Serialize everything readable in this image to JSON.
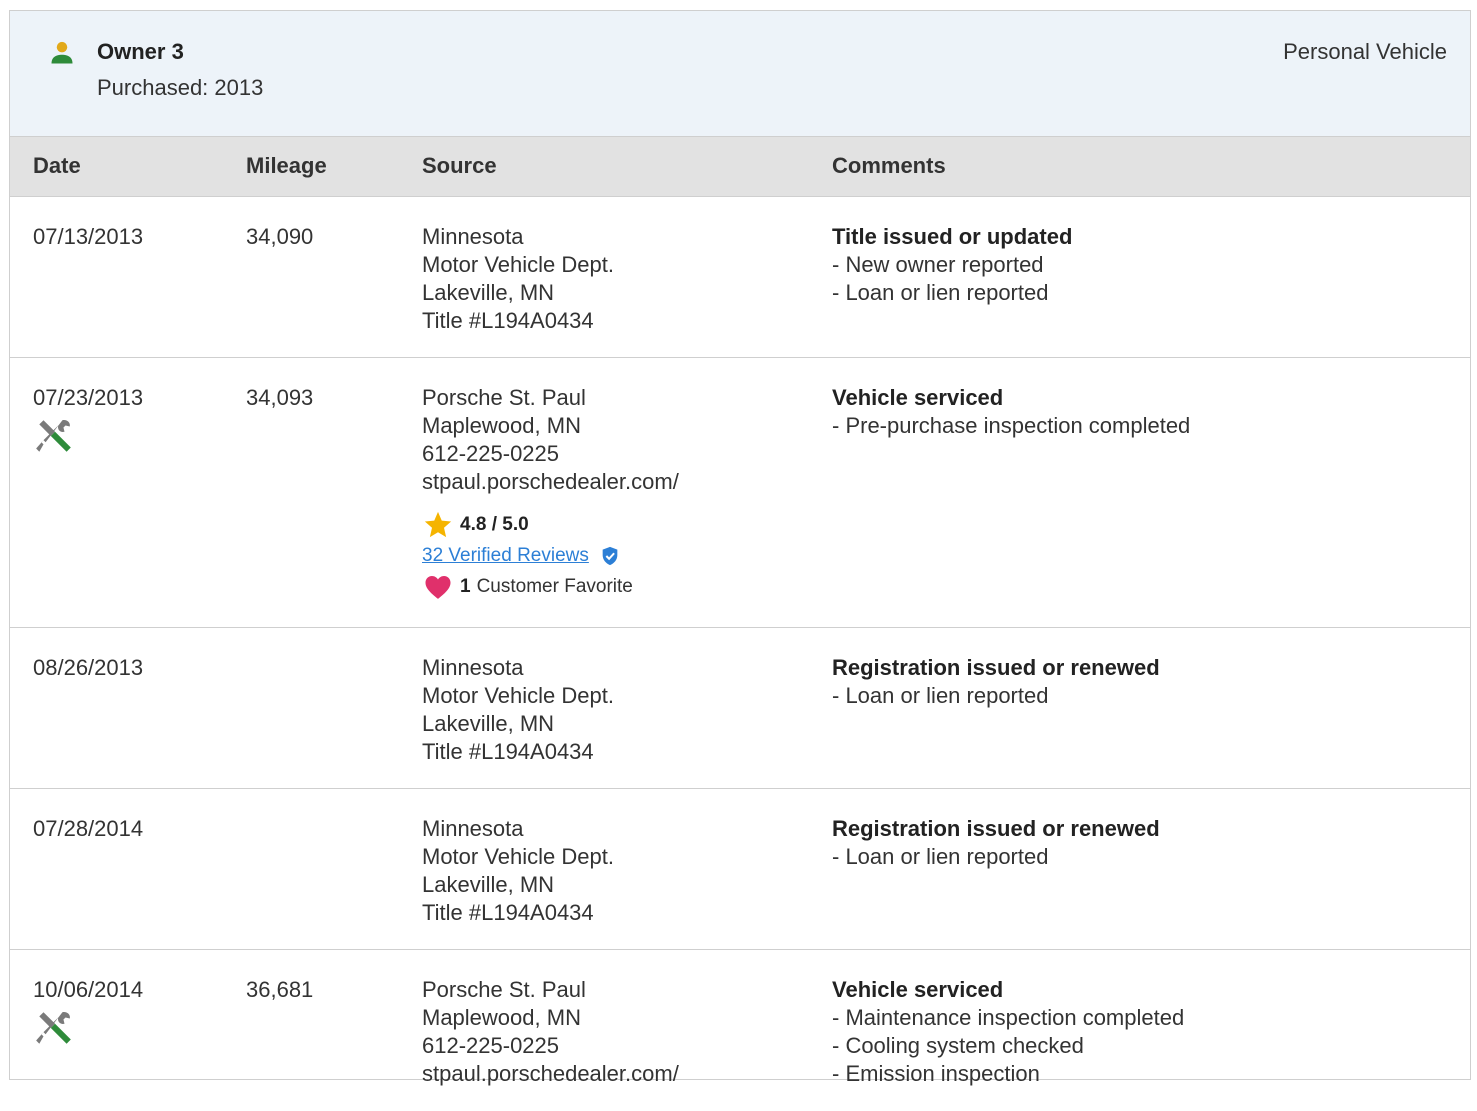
{
  "owner": {
    "title": "Owner 3",
    "purchased": "Purchased: 2013",
    "vehicle_type": "Personal Vehicle",
    "icon": "person-icon",
    "icon_color": "#2e8b3a"
  },
  "columns": {
    "date": "Date",
    "mileage": "Mileage",
    "source": "Source",
    "comments": "Comments"
  },
  "rows": [
    {
      "date": "07/13/2013",
      "mileage": "34,090",
      "source": [
        "Minnesota",
        "Motor Vehicle Dept.",
        "Lakeville, MN",
        "Title #L194A0434"
      ],
      "comment_title": "Title issued or updated",
      "comments": [
        "- New owner reported",
        "- Loan or lien reported"
      ]
    },
    {
      "date": "07/23/2013",
      "mileage": "34,093",
      "icon": "service-wrench-icon",
      "source": [
        "Porsche St. Paul",
        "Maplewood, MN",
        "612-225-0225",
        "stpaul.porschedealer.com/"
      ],
      "rating": "4.8 / 5.0",
      "reviews_link": "32 Verified Reviews",
      "favorite_count": "1",
      "favorite_label": "Customer Favorite",
      "comment_title": "Vehicle serviced",
      "comments": [
        "- Pre-purchase inspection completed"
      ]
    },
    {
      "date": "08/26/2013",
      "mileage": "",
      "source": [
        "Minnesota",
        "Motor Vehicle Dept.",
        "Lakeville, MN",
        "Title #L194A0434"
      ],
      "comment_title": "Registration issued or renewed",
      "comments": [
        "- Loan or lien reported"
      ]
    },
    {
      "date": "07/28/2014",
      "mileage": "",
      "source": [
        "Minnesota",
        "Motor Vehicle Dept.",
        "Lakeville, MN",
        "Title #L194A0434"
      ],
      "comment_title": "Registration issued or renewed",
      "comments": [
        "- Loan or lien reported"
      ]
    },
    {
      "date": "10/06/2014",
      "mileage": "36,681",
      "icon": "service-wrench-icon",
      "source": [
        "Porsche St. Paul",
        "Maplewood, MN",
        "612-225-0225",
        "stpaul.porschedealer.com/"
      ],
      "comment_title": "Vehicle serviced",
      "comments": [
        "- Maintenance inspection completed",
        "- Cooling system checked",
        "- Emission inspection"
      ]
    }
  ],
  "colors": {
    "header_bg": "#edf3f9",
    "column_header_bg": "#e2e2e2",
    "link": "#2c7fd6",
    "star": "#f5b400",
    "heart": "#e0306b",
    "shield": "#2c7fd6",
    "wrench_green": "#2e8b3a"
  }
}
